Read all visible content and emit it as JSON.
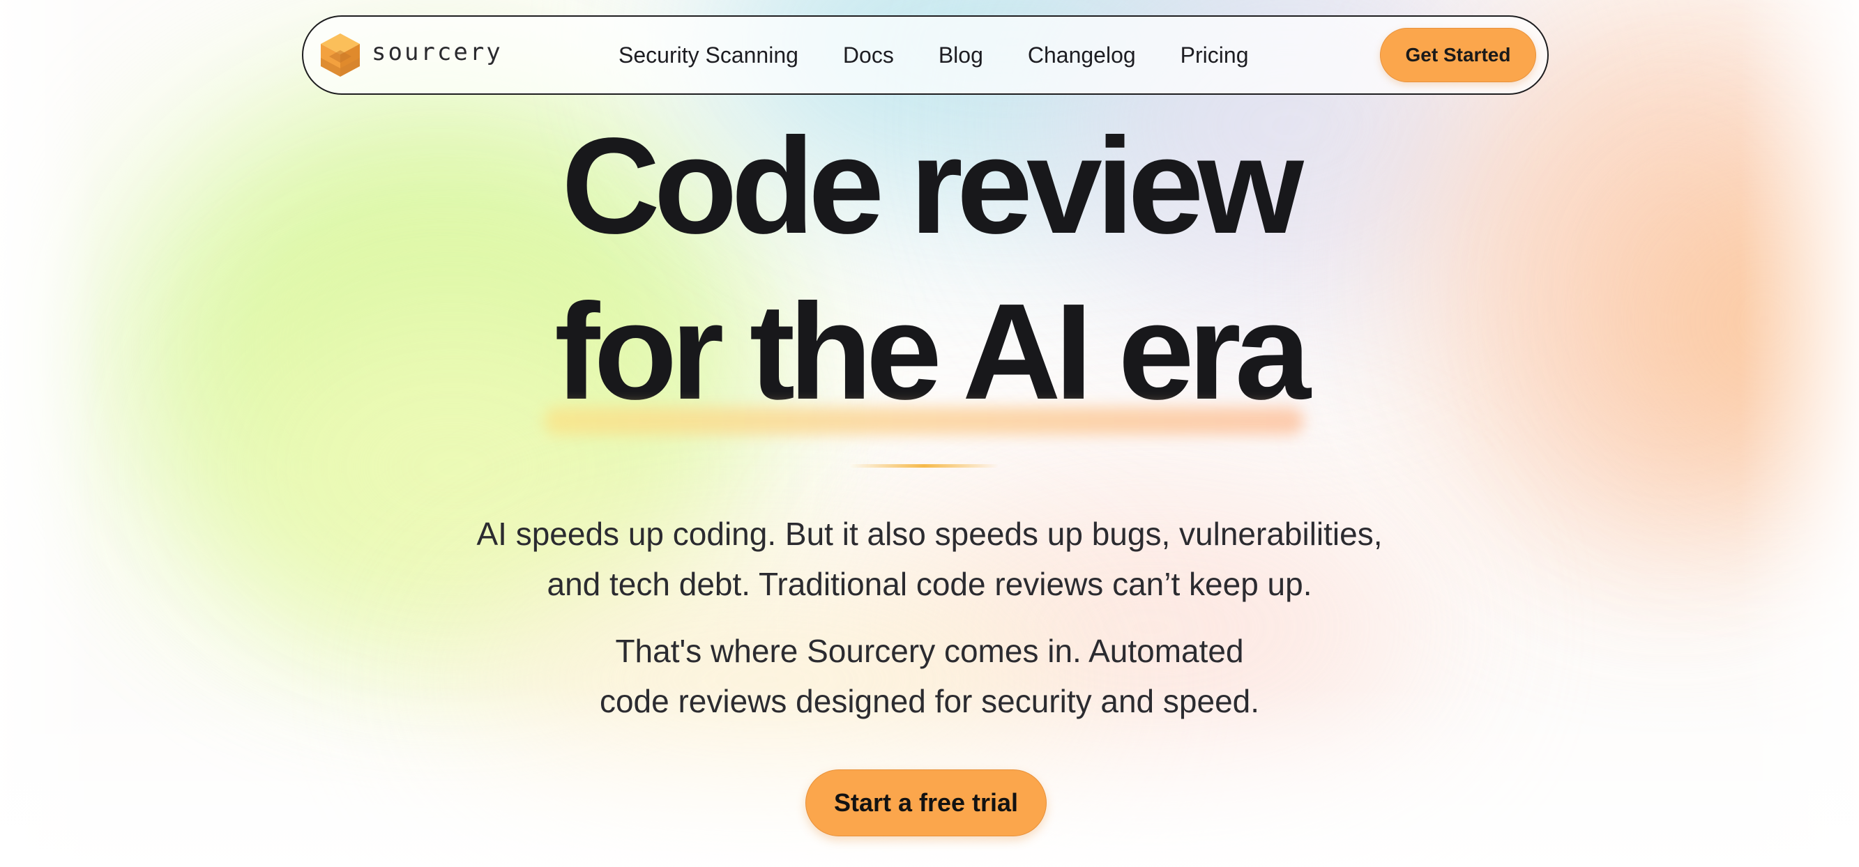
{
  "brand": {
    "name": "sourcery",
    "logo_icon": "sourcery-cube-logo",
    "accent_color": "#fba64c"
  },
  "nav": {
    "links": [
      {
        "label": "Security Scanning"
      },
      {
        "label": "Docs"
      },
      {
        "label": "Blog"
      },
      {
        "label": "Changelog"
      },
      {
        "label": "Pricing"
      }
    ],
    "cta_label": "Get Started"
  },
  "hero": {
    "headline_line1": "Code review",
    "headline_line2": "for the AI era",
    "paragraph1_line1": "AI speeds up coding. But it also speeds up bugs, vulnerabilities,",
    "paragraph1_line2": "and tech debt. Traditional code reviews can’t keep up.",
    "paragraph2_line1": "That's where Sourcery comes in. Automated",
    "paragraph2_line2": "code reviews designed for security and speed.",
    "cta_label": "Start a free trial"
  }
}
